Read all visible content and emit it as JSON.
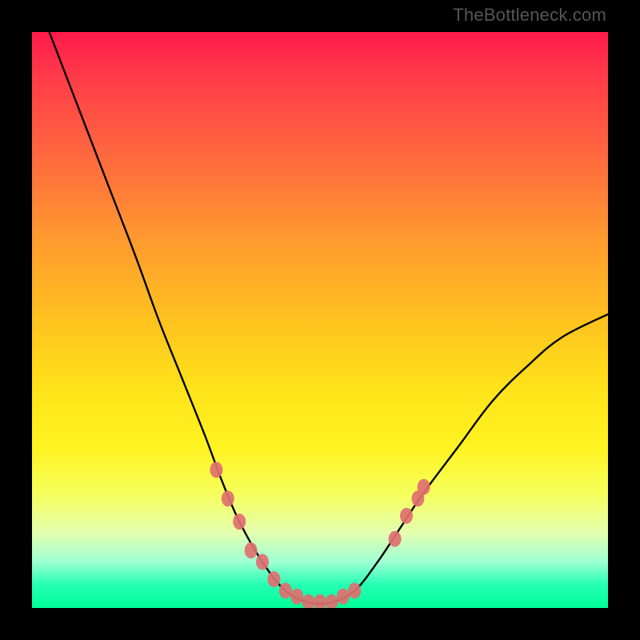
{
  "watermark": "TheBottleneck.com",
  "chart_data": {
    "type": "line",
    "title": "",
    "xlabel": "",
    "ylabel": "",
    "xlim": [
      0,
      100
    ],
    "ylim": [
      0,
      100
    ],
    "grid": false,
    "legend": false,
    "series": [
      {
        "name": "curve",
        "color": "#000000",
        "points": [
          {
            "x": 3,
            "y": 100
          },
          {
            "x": 8,
            "y": 87
          },
          {
            "x": 13,
            "y": 74
          },
          {
            "x": 18,
            "y": 61
          },
          {
            "x": 22,
            "y": 50
          },
          {
            "x": 26,
            "y": 40
          },
          {
            "x": 30,
            "y": 30
          },
          {
            "x": 33,
            "y": 22
          },
          {
            "x": 36,
            "y": 15
          },
          {
            "x": 40,
            "y": 8
          },
          {
            "x": 44,
            "y": 3
          },
          {
            "x": 48,
            "y": 1
          },
          {
            "x": 52,
            "y": 1
          },
          {
            "x": 56,
            "y": 3
          },
          {
            "x": 60,
            "y": 8
          },
          {
            "x": 64,
            "y": 14
          },
          {
            "x": 68,
            "y": 20
          },
          {
            "x": 74,
            "y": 28
          },
          {
            "x": 80,
            "y": 36
          },
          {
            "x": 86,
            "y": 42
          },
          {
            "x": 92,
            "y": 47
          },
          {
            "x": 100,
            "y": 51
          }
        ]
      },
      {
        "name": "markers",
        "color": "#e07070",
        "points": [
          {
            "x": 32,
            "y": 24
          },
          {
            "x": 34,
            "y": 19
          },
          {
            "x": 36,
            "y": 15
          },
          {
            "x": 38,
            "y": 10
          },
          {
            "x": 40,
            "y": 8
          },
          {
            "x": 42,
            "y": 5
          },
          {
            "x": 44,
            "y": 3
          },
          {
            "x": 46,
            "y": 2
          },
          {
            "x": 48,
            "y": 1
          },
          {
            "x": 50,
            "y": 1
          },
          {
            "x": 52,
            "y": 1
          },
          {
            "x": 54,
            "y": 2
          },
          {
            "x": 56,
            "y": 3
          },
          {
            "x": 63,
            "y": 12
          },
          {
            "x": 65,
            "y": 16
          },
          {
            "x": 67,
            "y": 19
          },
          {
            "x": 68,
            "y": 21
          }
        ]
      }
    ]
  }
}
